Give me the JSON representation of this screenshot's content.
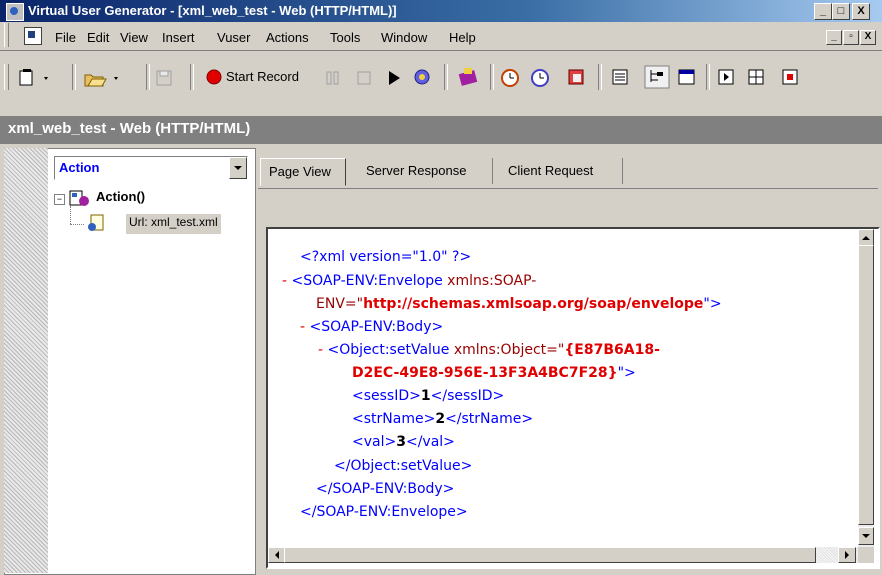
{
  "window": {
    "title": "Virtual User Generator - [xml_web_test - Web (HTTP/HTML)]",
    "controls": {
      "minimize": "_",
      "maximize": "□",
      "close": "X"
    }
  },
  "menu": {
    "items": [
      "File",
      "Edit",
      "View",
      "Insert",
      "Vuser",
      "Actions",
      "Tools",
      "Window",
      "Help"
    ],
    "mdi_controls": {
      "minimize": "_",
      "restore": "▫",
      "close": "X"
    }
  },
  "toolbar": {
    "start_record_label": "Start Record"
  },
  "script_header": "xml_web_test - Web (HTTP/HTML)",
  "tree": {
    "combo_value": "Action",
    "root_label": "Action()",
    "child_label": "Url: xml_test.xml"
  },
  "tabs": [
    "Page View",
    "Server Response",
    "Client Request"
  ],
  "xml": {
    "line1": "<?xml version=\"1.0\" ?>",
    "line2_dash": "-",
    "line2_tag": "<SOAP-ENV:Envelope",
    "line2_attr": "xmlns:SOAP-",
    "line3_attr": "ENV=\"",
    "line3_val": "http://schemas.xmlsoap.org/soap/envelope",
    "line3_end": "\">",
    "line4_dash": "-",
    "line4_tag": "<SOAP-ENV:Body>",
    "line5_dash": "-",
    "line5_tag": "<Object:setValue",
    "line5_attr": "xmlns:Object=\"",
    "line5_val": "{E87B6A18-",
    "line6_val": "D2EC-49E8-956E-13F3A4BC7F28}",
    "line6_end": "\">",
    "line7_open": "<sessID>",
    "line7_val": "1",
    "line7_close": "</sessID>",
    "line8_open": "<strName>",
    "line8_val": "2",
    "line8_close": "</strName>",
    "line9_open": "<val>",
    "line9_val": "3",
    "line9_close": "</val>",
    "line10": "</Object:setValue>",
    "line11": "</SOAP-ENV:Body>",
    "line12": "</SOAP-ENV:Envelope>"
  },
  "colors": {
    "titlebar_start": "#0a246a",
    "tag_blue": "#0000ff",
    "attr_red": "#990000",
    "value_red": "#e00000"
  }
}
